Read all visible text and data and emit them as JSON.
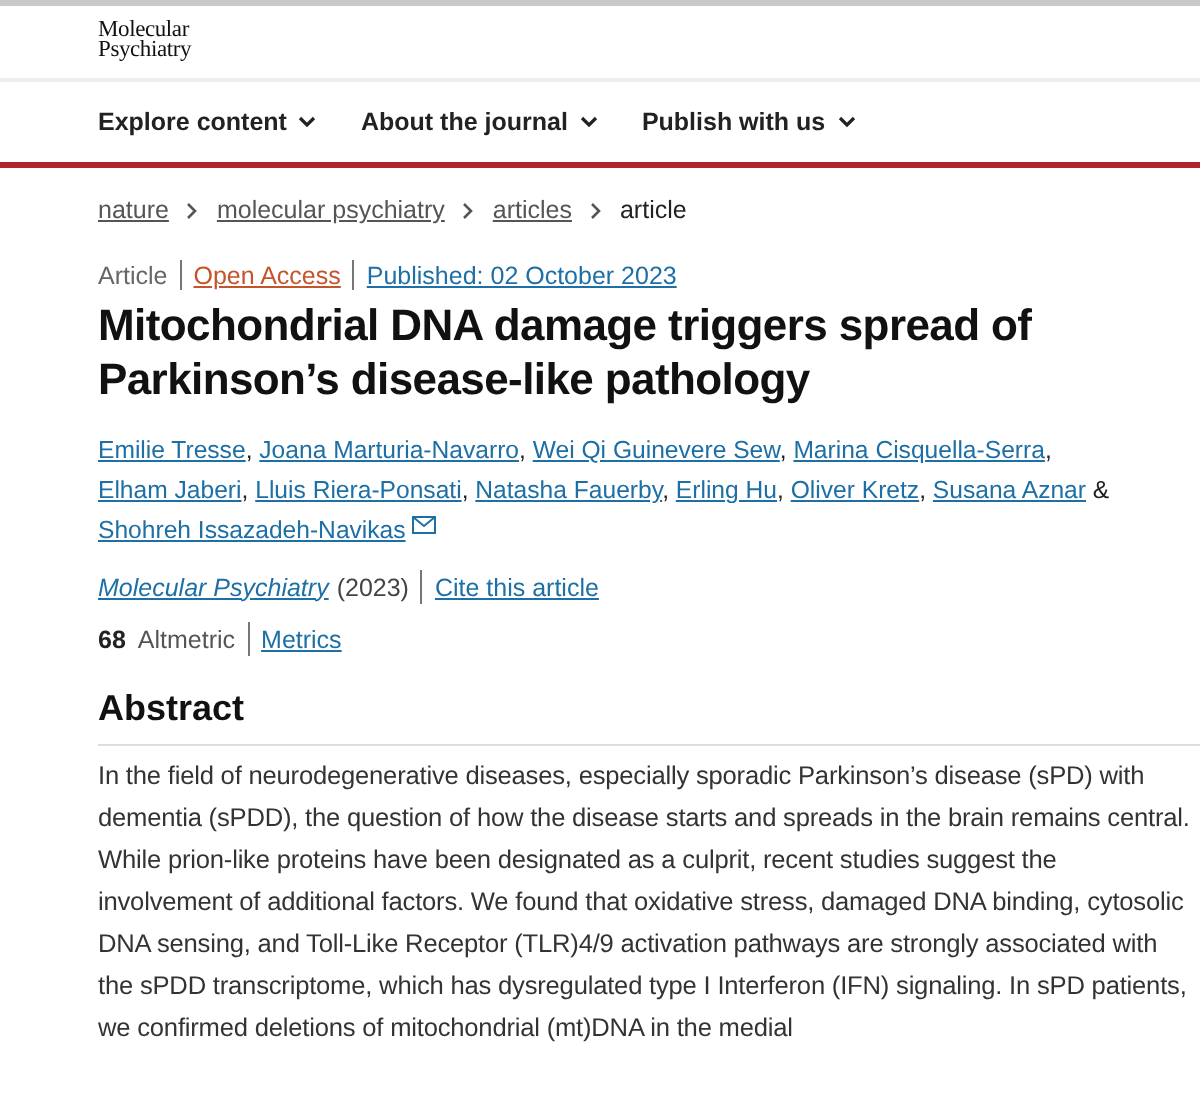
{
  "logo": {
    "line_1": "Molecular",
    "line_2": "Psychiatry"
  },
  "nav": [
    {
      "label": "Explore content"
    },
    {
      "label": "About the journal"
    },
    {
      "label": "Publish with us"
    }
  ],
  "breadcrumb": [
    {
      "label": "nature",
      "link": true
    },
    {
      "label": "molecular psychiatry",
      "link": true
    },
    {
      "label": "articles",
      "link": true
    },
    {
      "label": "article",
      "link": false
    }
  ],
  "meta": {
    "type": "Article",
    "access": "Open Access",
    "published": "Published: 02 October 2023"
  },
  "title": "Mitochondrial DNA damage triggers spread of Parkinson’s disease-like pathology",
  "authors": [
    {
      "name": "Emilie Tresse",
      "separator": ","
    },
    {
      "name": "Joana Marturia-Navarro",
      "separator": ","
    },
    {
      "name": "Wei Qi Guinevere Sew",
      "separator": ","
    },
    {
      "name": "Marina Cisquella-Serra",
      "separator": ","
    },
    {
      "name": "Elham Jaberi",
      "separator": ","
    },
    {
      "name": "Lluis Riera-Ponsati",
      "separator": ","
    },
    {
      "name": "Natasha Fauerby",
      "separator": ","
    },
    {
      "name": "Erling Hu",
      "separator": ","
    },
    {
      "name": "Oliver Kretz",
      "separator": ","
    },
    {
      "name": "Susana Aznar",
      "separator": "&"
    },
    {
      "name": "Shohreh Issazadeh-Navikas",
      "corresponding": true
    }
  ],
  "citation": {
    "journal": "Molecular Psychiatry",
    "year": "(2023)",
    "cite": "Cite this article"
  },
  "metrics": {
    "count": "68",
    "label": "Altmetric",
    "link": "Metrics"
  },
  "abstract": {
    "heading": "Abstract",
    "text": "In the field of neurodegenerative diseases, especially sporadic Parkinson’s disease (sPD) with dementia (sPDD), the question of how the disease starts and spreads in the brain remains central. While prion-like proteins have been designated as a culprit, recent studies suggest the involvement of additional factors. We found that oxidative stress, damaged DNA binding, cytosolic DNA sensing, and Toll-Like Receptor (TLR)4/9 activation pathways are strongly associated with the sPDD transcriptome, which has dysregulated type I Interferon (IFN) signaling. In sPD patients, we confirmed deletions of mitochondrial (mt)DNA in the medial"
  }
}
